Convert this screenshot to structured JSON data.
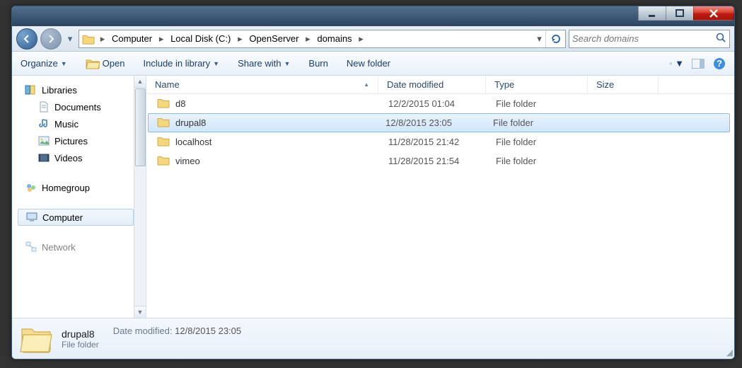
{
  "titlebar": {},
  "breadcrumbs": [
    "Computer",
    "Local Disk (C:)",
    "OpenServer",
    "domains"
  ],
  "search": {
    "placeholder": "Search domains"
  },
  "toolbar": {
    "organize": "Organize",
    "open": "Open",
    "include": "Include in library",
    "share": "Share with",
    "burn": "Burn",
    "newfolder": "New folder"
  },
  "tree": {
    "libraries": "Libraries",
    "documents": "Documents",
    "music": "Music",
    "pictures": "Pictures",
    "videos": "Videos",
    "homegroup": "Homegroup",
    "computer": "Computer",
    "network": "Network"
  },
  "columns": {
    "name": "Name",
    "date": "Date modified",
    "type": "Type",
    "size": "Size"
  },
  "files": [
    {
      "name": "d8",
      "date": "12/2/2015 01:04",
      "type": "File folder",
      "selected": false
    },
    {
      "name": "drupal8",
      "date": "12/8/2015 23:05",
      "type": "File folder",
      "selected": true
    },
    {
      "name": "localhost",
      "date": "11/28/2015 21:42",
      "type": "File folder",
      "selected": false
    },
    {
      "name": "vimeo",
      "date": "11/28/2015 21:54",
      "type": "File folder",
      "selected": false
    }
  ],
  "details": {
    "name": "drupal8",
    "type": "File folder",
    "meta_label": "Date modified:",
    "meta_value": "12/8/2015 23:05"
  }
}
